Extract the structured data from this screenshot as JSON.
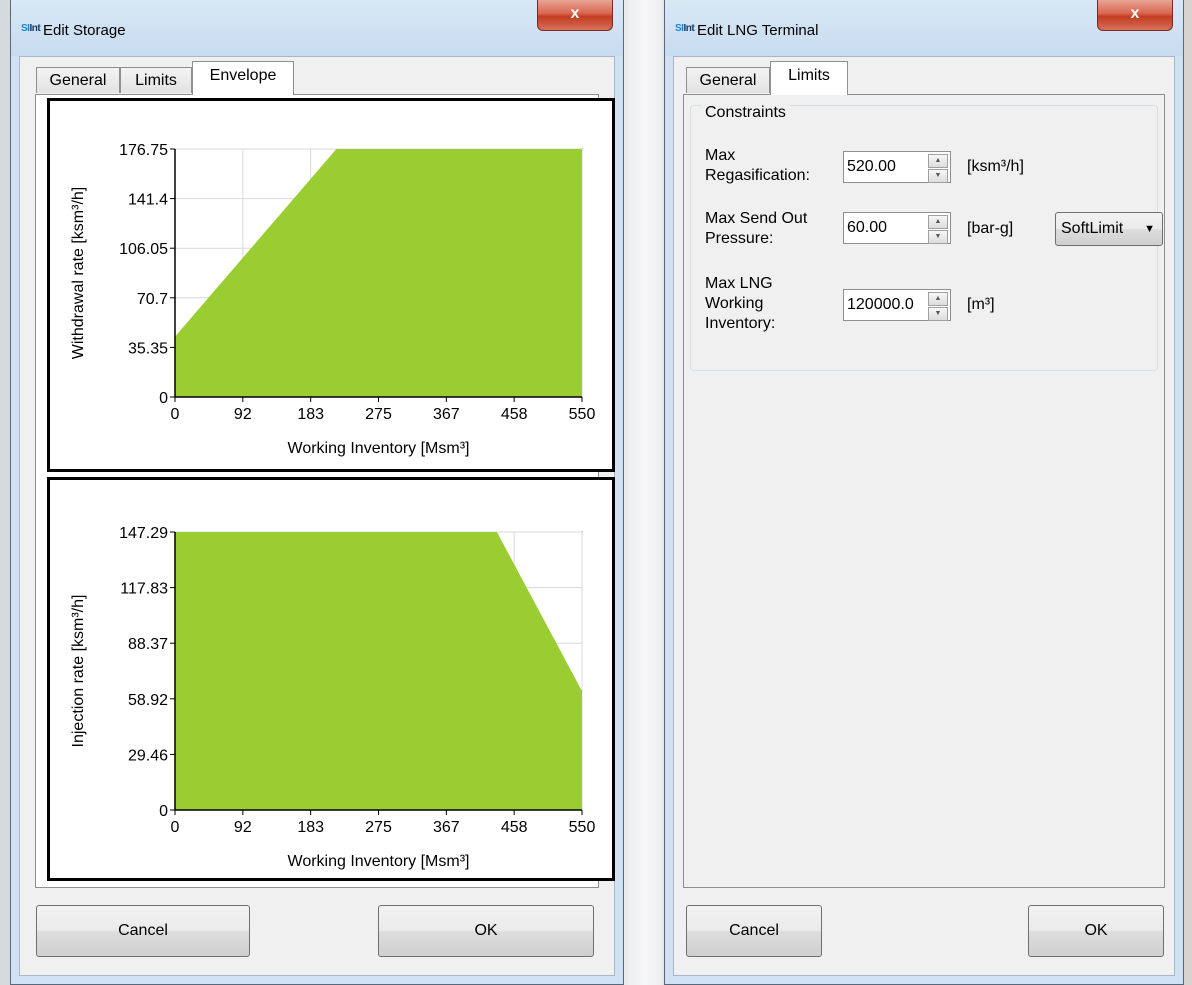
{
  "storage_dialog": {
    "title": "Edit Storage",
    "logo_text": "SIMONE Int",
    "close_glyph": "x",
    "tabs": [
      {
        "label": "General"
      },
      {
        "label": "Limits"
      },
      {
        "label": "Envelope",
        "active": true
      }
    ],
    "cancel_label": "Cancel",
    "ok_label": "OK"
  },
  "lng_dialog": {
    "title": "Edit LNG Terminal",
    "logo_text": "SIMONE Int",
    "close_glyph": "x",
    "tabs": [
      {
        "label": "General"
      },
      {
        "label": "Limits",
        "active": true
      }
    ],
    "group_title": "Constraints",
    "fields": [
      {
        "label_lines": [
          "Max",
          "Regasification:"
        ],
        "value": "520.00",
        "unit": "[ksm³/h]"
      },
      {
        "label_lines": [
          "Max Send Out",
          "Pressure:"
        ],
        "value": "60.00",
        "unit": "[bar-g]",
        "dropdown": "SoftLimit"
      },
      {
        "label_lines": [
          "Max LNG",
          "Working",
          "Inventory:"
        ],
        "value": "120000.0",
        "unit": "[m³]"
      }
    ],
    "cancel_label": "Cancel",
    "ok_label": "OK"
  },
  "colors": {
    "fill": "#9acd32",
    "grid": "#d9d9d9",
    "close": "#c8452d"
  },
  "chart_data": [
    {
      "type": "area",
      "xlabel": "Working Inventory [Msm³]",
      "ylabel": "Withdrawal rate [ksm³/h]",
      "xlim": [
        0,
        550
      ],
      "ylim": [
        0,
        176.75
      ],
      "x_ticks": [
        "0",
        "92",
        "183",
        "275",
        "367",
        "458",
        "550"
      ],
      "y_ticks": [
        "0",
        "35.35",
        "70.7",
        "106.05",
        "141.4",
        "176.75"
      ],
      "grid": true,
      "x": [
        0,
        218,
        550
      ],
      "y": [
        43,
        176.75,
        176.75
      ]
    },
    {
      "type": "area",
      "xlabel": "Working Inventory [Msm³]",
      "ylabel": "Injection rate [ksm³/h]",
      "xlim": [
        0,
        550
      ],
      "ylim": [
        0,
        147.29
      ],
      "x_ticks": [
        "0",
        "92",
        "183",
        "275",
        "367",
        "458",
        "550"
      ],
      "y_ticks": [
        "0",
        "29.46",
        "58.92",
        "88.37",
        "117.83",
        "147.29"
      ],
      "grid": true,
      "x": [
        0,
        435,
        550
      ],
      "y": [
        147.29,
        147.29,
        63
      ]
    }
  ]
}
